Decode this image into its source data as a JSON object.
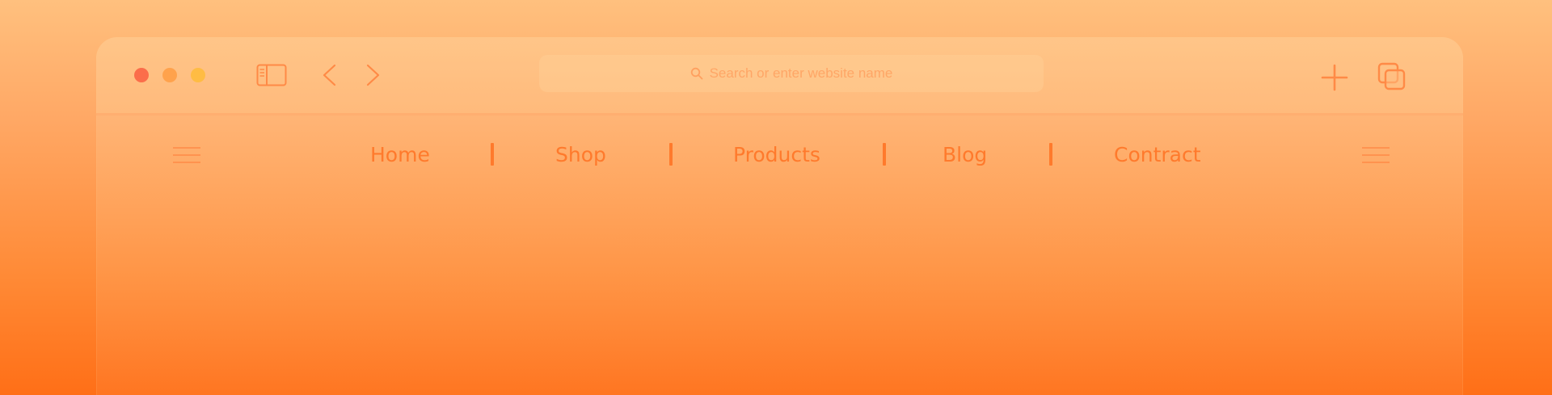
{
  "toolbar": {
    "traffic_lights": {
      "close_color": "#fb6d4a",
      "minimize_color": "#ffa24c",
      "maximize_color": "#ffbc43"
    },
    "icons": [
      "sidebar-icon",
      "back-icon",
      "forward-icon",
      "plus-icon",
      "tabs-icon"
    ],
    "address_bar": {
      "icon": "search-icon",
      "placeholder": "Search or enter website name"
    }
  },
  "nav": {
    "left_menu_icon": "hamburger-icon",
    "right_menu_icon": "hamburger-icon",
    "links": [
      {
        "label": "Home"
      },
      {
        "label": "Shop"
      },
      {
        "label": "Products"
      },
      {
        "label": "Blog"
      },
      {
        "label": "Contract"
      }
    ],
    "accent_color": "#ff7a2c"
  },
  "background": {
    "gradient_top": "#ffc07e",
    "gradient_bottom": "#ff6f17"
  }
}
